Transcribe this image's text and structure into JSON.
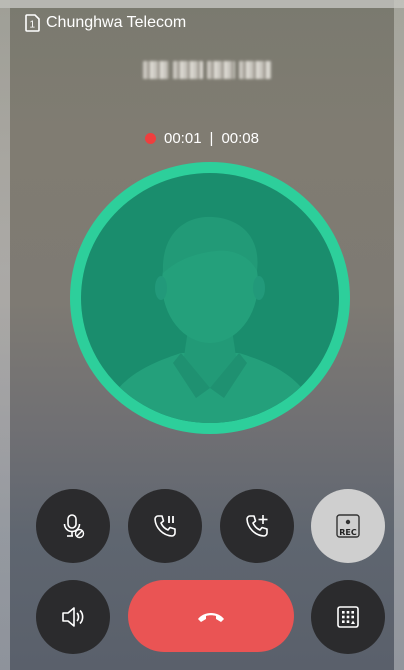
{
  "status_bar": {
    "sim_slot": "1",
    "carrier": "Chunghwa Telecom"
  },
  "call": {
    "elapsed": "00:01",
    "separator": "|",
    "total": "00:08",
    "recording_color": "#ef3e3e"
  },
  "controls": {
    "row1": [
      {
        "name": "mute",
        "icon": "mic-mute-icon"
      },
      {
        "name": "hold",
        "icon": "phone-pause-icon"
      },
      {
        "name": "add-call",
        "icon": "phone-add-icon"
      },
      {
        "name": "record",
        "icon": "record-icon",
        "label": "REC"
      }
    ],
    "row2": [
      {
        "name": "speaker",
        "icon": "speaker-icon"
      },
      {
        "name": "end-call",
        "icon": "hangup-icon",
        "color": "#ea5454"
      },
      {
        "name": "keypad",
        "icon": "dialpad-icon"
      }
    ]
  },
  "colors": {
    "avatar_ring": "#2dcf9b",
    "avatar_fill": "#1a8d6d",
    "button_dark": "#2b2b2d",
    "button_light": "#cfcfcf"
  }
}
